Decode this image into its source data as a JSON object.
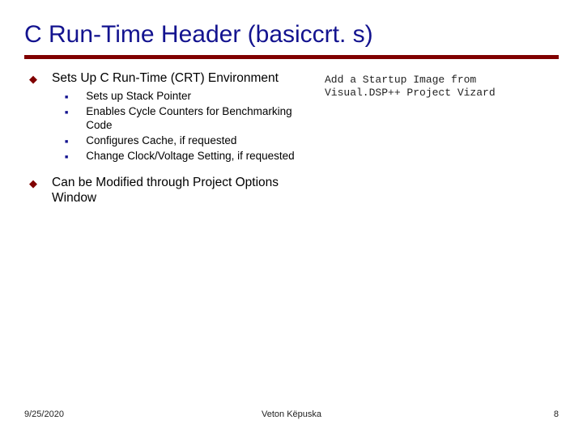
{
  "title": "C Run-Time Header (basiccrt. s)",
  "right_note_line1": "Add a Startup Image from",
  "right_note_line2": "Visual.DSP++ Project Vizard",
  "bullets": {
    "item0": {
      "text": "Sets Up C Run-Time (CRT) Environment",
      "children": {
        "c0": "Sets up Stack Pointer",
        "c1": "Enables Cycle Counters for Benchmarking Code",
        "c2": "Configures Cache, if requested",
        "c3": "Change Clock/Voltage Setting, if requested"
      }
    },
    "item1": {
      "text": "Can be Modified through Project Options Window"
    }
  },
  "footer": {
    "date": "9/25/2020",
    "author": "Veton Këpuska",
    "page": "8"
  }
}
